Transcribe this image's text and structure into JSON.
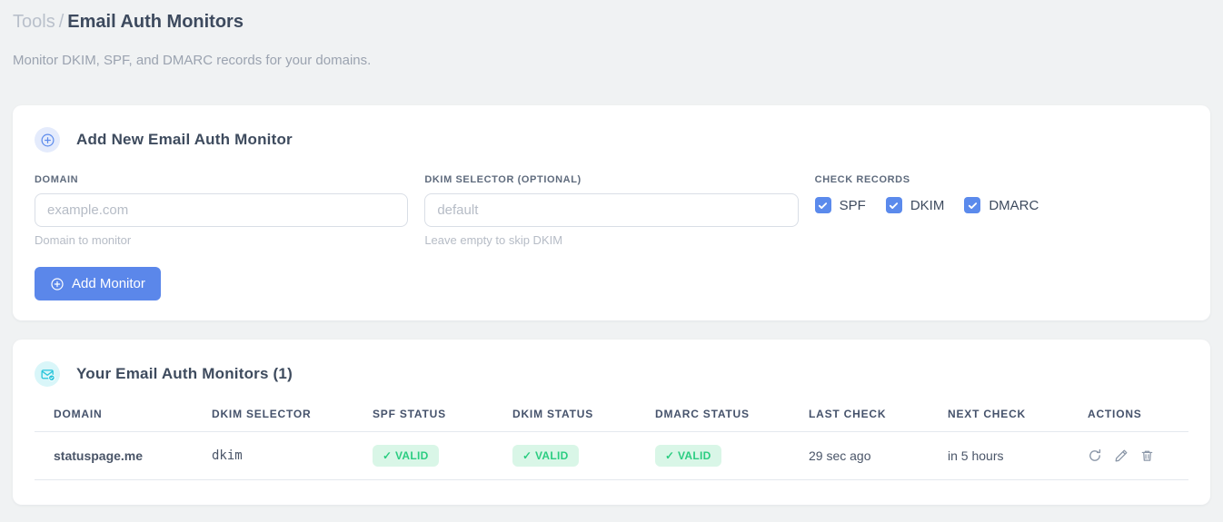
{
  "colors": {
    "accent_blue": "#5b87ea",
    "accent_cyan": "#25c4da",
    "badge_green_bg": "#d9f6e7",
    "badge_green_text": "#2bcd81",
    "code_pink": "#e8538f",
    "page_bg": "#f0f2f3"
  },
  "header": {
    "breadcrumb_section": "Tools",
    "breadcrumb_separator": "/",
    "title": "Email Auth Monitors",
    "subtitle": "Monitor DKIM, SPF, and DMARC records for your domains."
  },
  "add_card": {
    "icon": "circle-plus-icon",
    "title": "Add New Email Auth Monitor",
    "domain_field": {
      "label": "DOMAIN",
      "placeholder": "example.com",
      "value": "",
      "helper": "Domain to monitor"
    },
    "dkim_field": {
      "label": "DKIM SELECTOR (OPTIONAL)",
      "placeholder": "default",
      "value": "",
      "helper": "Leave empty to skip DKIM"
    },
    "check_records": {
      "label": "CHECK RECORDS",
      "options": [
        {
          "label": "SPF",
          "checked": true
        },
        {
          "label": "DKIM",
          "checked": true
        },
        {
          "label": "DMARC",
          "checked": true
        }
      ]
    },
    "submit_button": {
      "icon": "circle-plus-icon",
      "label": "Add Monitor"
    }
  },
  "monitors_card": {
    "icon": "envelope-check-icon",
    "title": "Your Email Auth Monitors (1)",
    "table": {
      "headers": [
        "DOMAIN",
        "DKIM SELECTOR",
        "SPF STATUS",
        "DKIM STATUS",
        "DMARC STATUS",
        "LAST CHECK",
        "NEXT CHECK",
        "ACTIONS"
      ],
      "rows": [
        {
          "domain": "statuspage.me",
          "dkim_selector": "dkim",
          "spf_status": "✓ VALID",
          "dkim_status": "✓ VALID",
          "dmarc_status": "✓ VALID",
          "last_check": "29 sec ago",
          "next_check": "in 5 hours",
          "actions": [
            "refresh-icon",
            "edit-icon",
            "delete-icon"
          ]
        }
      ]
    }
  }
}
